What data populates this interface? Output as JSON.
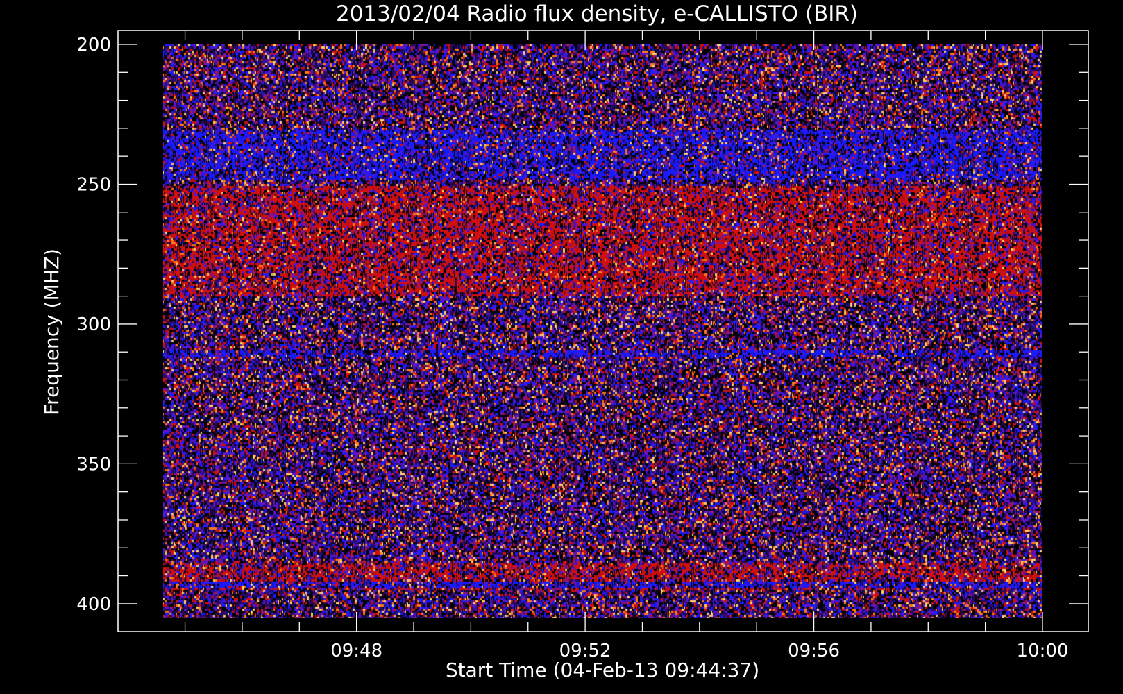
{
  "chart_data": {
    "type": "heatmap",
    "title": "2013/02/04  Radio flux density, e-CALLISTO (BIR)",
    "xlabel": "Start Time (04-Feb-13 09:44:37)",
    "ylabel": "Frequency (MHZ)",
    "x_range": [
      "09:44:37",
      "10:00:00"
    ],
    "y_range": [
      200,
      405
    ],
    "y_axis": "inverted",
    "xticks": [
      "09:48",
      "09:52",
      "09:56",
      "10:00"
    ],
    "yticks": [
      200,
      250,
      300,
      350,
      400
    ],
    "colormap": [
      "#000000",
      "#2a0a60",
      "#5a16c8",
      "#1a1aff",
      "#d01010",
      "#ff7a1a",
      "#ffd070"
    ],
    "bands": [
      {
        "freq_range": [
          230,
          248
        ],
        "dominant": "blue"
      },
      {
        "freq_range": [
          250,
          290
        ],
        "dominant": "red"
      },
      {
        "freq_range": [
          288,
          290
        ],
        "dominant": "violet"
      },
      {
        "freq_range": [
          309,
          311
        ],
        "dominant": "blue"
      },
      {
        "freq_range": [
          385,
          395
        ],
        "dominant": "red"
      },
      {
        "freq_range": [
          392,
          394
        ],
        "dominant": "blue"
      }
    ]
  }
}
